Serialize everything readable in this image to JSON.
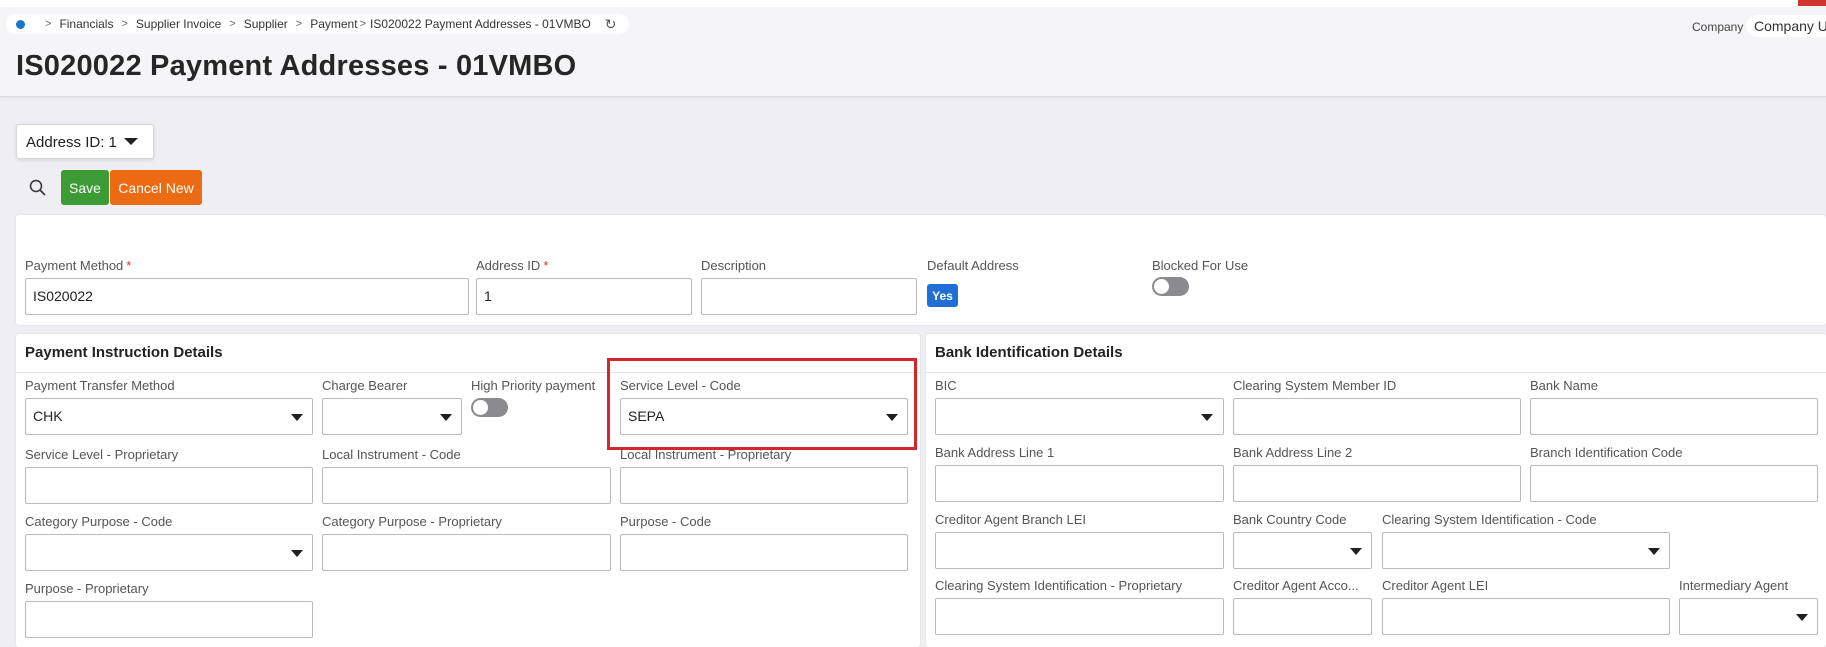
{
  "breadcrumb": {
    "items": [
      "Financials",
      "Supplier Invoice",
      "Supplier",
      "Payment",
      "IS020022 Payment Addresses - 01VMBO"
    ]
  },
  "company": {
    "label": "Company",
    "value": "Company U"
  },
  "page": {
    "title": "IS020022 Payment Addresses - 01VMBO"
  },
  "address_selector": {
    "label": "Address ID: 1"
  },
  "toolbar": {
    "save_label": "Save",
    "cancel_label": "Cancel New"
  },
  "header_fields": {
    "payment_method": {
      "label": "Payment Method",
      "value": "IS020022",
      "required": "*"
    },
    "address_id": {
      "label": "Address ID",
      "value": "1",
      "required": "*"
    },
    "description": {
      "label": "Description",
      "value": ""
    },
    "default_address": {
      "label": "Default Address",
      "value": "Yes"
    },
    "blocked_for_use": {
      "label": "Blocked For Use",
      "value": "off"
    }
  },
  "payment_instruction": {
    "title": "Payment Instruction Details",
    "payment_transfer_method": {
      "label": "Payment Transfer Method",
      "value": "CHK"
    },
    "charge_bearer": {
      "label": "Charge Bearer",
      "value": ""
    },
    "high_priority": {
      "label": "High Priority payment",
      "value": "off"
    },
    "service_level_code": {
      "label": "Service Level - Code",
      "value": "SEPA"
    },
    "service_level_proprietary": {
      "label": "Service Level - Proprietary",
      "value": ""
    },
    "local_instrument_code": {
      "label": "Local Instrument - Code",
      "value": ""
    },
    "local_instrument_proprietary": {
      "label": "Local Instrument - Proprietary",
      "value": ""
    },
    "category_purpose_code": {
      "label": "Category Purpose - Code",
      "value": ""
    },
    "category_purpose_proprietary": {
      "label": "Category Purpose - Proprietary",
      "value": ""
    },
    "purpose_code": {
      "label": "Purpose - Code",
      "value": ""
    },
    "purpose_proprietary": {
      "label": "Purpose - Proprietary",
      "value": ""
    }
  },
  "bank_identification": {
    "title": "Bank Identification Details",
    "bic": {
      "label": "BIC",
      "value": ""
    },
    "clearing_system_member_id": {
      "label": "Clearing System Member ID",
      "value": ""
    },
    "bank_name": {
      "label": "Bank Name",
      "value": ""
    },
    "bank_address_line_1": {
      "label": "Bank Address Line 1",
      "value": ""
    },
    "bank_address_line_2": {
      "label": "Bank Address Line 2",
      "value": ""
    },
    "branch_identification_code": {
      "label": "Branch Identification Code",
      "value": ""
    },
    "creditor_agent_branch_lei": {
      "label": "Creditor Agent Branch LEI",
      "value": ""
    },
    "bank_country_code": {
      "label": "Bank Country Code",
      "value": ""
    },
    "clearing_system_identification_code": {
      "label": "Clearing System Identification - Code",
      "value": ""
    },
    "clearing_system_identification_proprietary": {
      "label": "Clearing System Identification - Proprietary",
      "value": ""
    },
    "creditor_agent_account": {
      "label": "Creditor Agent Acco...",
      "value": ""
    },
    "creditor_agent_lei": {
      "label": "Creditor Agent LEI",
      "value": ""
    },
    "intermediary_agent": {
      "label": "Intermediary Agent",
      "value": ""
    }
  },
  "colors": {
    "save": "#3c9b35",
    "cancel": "#ec6a12",
    "yes_badge": "#1f6fd6",
    "highlight": "#d3262e",
    "required": "#d0362d"
  }
}
